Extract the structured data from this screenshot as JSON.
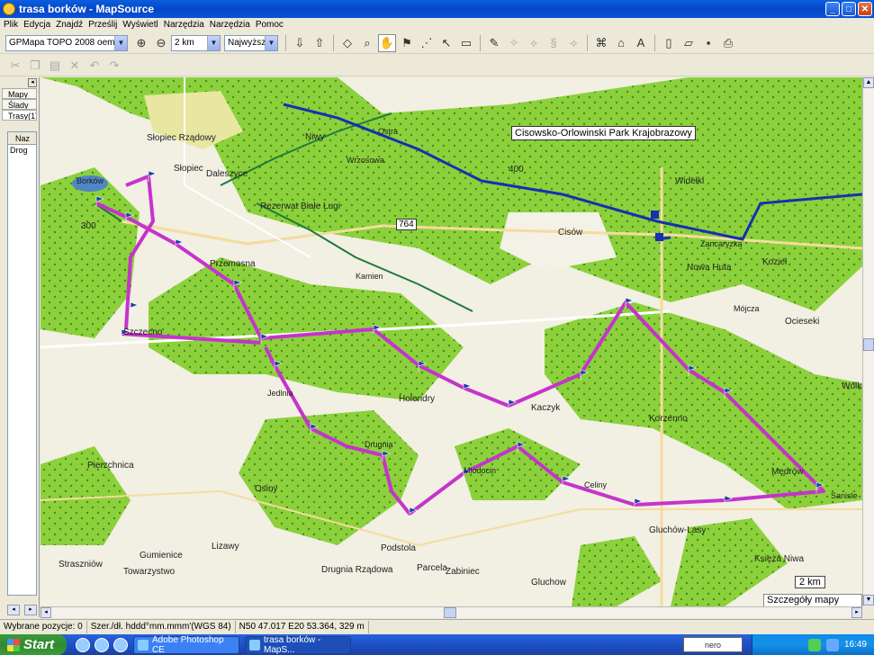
{
  "window": {
    "title": "trasa borków - MapSource"
  },
  "menu": [
    "Plik",
    "Edycja",
    "Znajdź",
    "Prześlij",
    "Wyświetl",
    "Narzędzia",
    "Narzędzia",
    "Pomoc"
  ],
  "toolbar": {
    "map_product": "GPMapa TOPO 2008 oem",
    "zoom_scale": "2 km",
    "detail_level": "Najwyższe"
  },
  "left_panel": {
    "tabs": [
      "Mapy",
      "Ślady",
      "Trasy(1)"
    ],
    "column_header": "Naz",
    "rows": [
      "Drog"
    ]
  },
  "map": {
    "park_label": "Cisowsko-Orlowinski Park Krajobrazowy",
    "road_number": "764",
    "road_number_2": "300",
    "road_number_3": "400",
    "scale_label": "2 km",
    "detail_label": "Szczegóły mapy GPS",
    "places": [
      "Słopiec Rządowy",
      "Słopiec",
      "Daleszyce",
      "Borków",
      "Niwy",
      "Rezerwat Białe Ługi",
      "Przemosna",
      "Cisów",
      "Widełki",
      "Kozieł",
      "Nowa Huta",
      "Ocieseki",
      "Wólka",
      "Mójcza",
      "Holendry",
      "Korzenno",
      "Kaczyk",
      "Pierzchnica",
      "Osiny",
      "Gumienice",
      "Straszniów",
      "Lizawy",
      "Towarzystwo",
      "Podstola",
      "Drugnia Rządowa",
      "Parcela",
      "Zabiniec",
      "Gluchow",
      "Gluchów-Lasy",
      "Celiny",
      "Mędrów",
      "Księża Niwa",
      "Sanisle",
      "Ostra",
      "Wrzosowa",
      "Kamien",
      "Zancaryzka",
      "Jedlnia",
      "Mlodocin",
      "Szczecno",
      "Drugnia"
    ]
  },
  "status": {
    "selected": "Wybrane pozycje: 0",
    "format": "Szer./dł. hddd°mm.mmm'(WGS 84)",
    "coords": "N50 47.017 E20 53.364, 329 m"
  },
  "taskbar": {
    "start": "Start",
    "items": [
      "Adobe Photoshop CE",
      "trasa borków - MapS..."
    ],
    "nero": "nero",
    "clock": "16:49"
  }
}
